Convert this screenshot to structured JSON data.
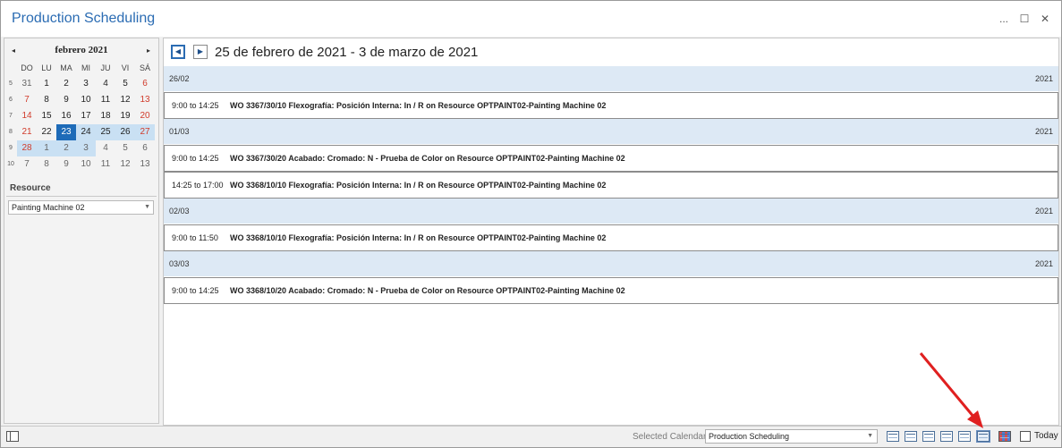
{
  "window": {
    "title": "Production Scheduling",
    "controls": {
      "more": "...",
      "maximize": "☐",
      "close": "✕"
    }
  },
  "mini_calendar": {
    "month_label": "febrero 2021",
    "prev": "◂",
    "next": "▸",
    "weekdays": [
      "DO",
      "LU",
      "MA",
      "MI",
      "JU",
      "VI",
      "SÁ"
    ],
    "weeks": [
      {
        "num": "5",
        "days": [
          "31",
          "1",
          "2",
          "3",
          "4",
          "5",
          "6"
        ]
      },
      {
        "num": "6",
        "days": [
          "7",
          "8",
          "9",
          "10",
          "11",
          "12",
          "13"
        ]
      },
      {
        "num": "7",
        "days": [
          "14",
          "15",
          "16",
          "17",
          "18",
          "19",
          "20"
        ]
      },
      {
        "num": "8",
        "days": [
          "21",
          "22",
          "23",
          "24",
          "25",
          "26",
          "27"
        ]
      },
      {
        "num": "9",
        "days": [
          "28",
          "1",
          "2",
          "3",
          "4",
          "5",
          "6"
        ]
      },
      {
        "num": "10",
        "days": [
          "7",
          "8",
          "9",
          "10",
          "11",
          "12",
          "13"
        ]
      }
    ],
    "selected_day": "23",
    "accent_color": "#1e6bb8",
    "weekend_color": "#d13b2b",
    "range_color": "#c9e0f3"
  },
  "resource": {
    "label": "Resource",
    "selected": "Painting Machine 02"
  },
  "scheduler": {
    "prev_icon": "◀",
    "next_icon": "▶",
    "date_range": "25 de febrero de 2021 - 3 de marzo de 2021",
    "days": [
      {
        "date": "26/02",
        "year": "2021",
        "appointments": [
          {
            "time": "9:00 to 14:25",
            "description": "WO 3367/30/10 Flexografía: Posición Interna: In / R on Resource OPTPAINT02-Painting Machine 02"
          }
        ]
      },
      {
        "date": "01/03",
        "year": "2021",
        "appointments": [
          {
            "time": "9:00 to 14:25",
            "description": "WO 3367/30/20 Acabado: Cromado: N - Prueba de Color on Resource OPTPAINT02-Painting Machine 02"
          },
          {
            "time": "14:25 to 17:00",
            "description": "WO 3368/10/10 Flexografía: Posición Interna: In / R on Resource OPTPAINT02-Painting Machine 02"
          }
        ]
      },
      {
        "date": "02/03",
        "year": "2021",
        "appointments": [
          {
            "time": "9:00 to 11:50",
            "description": "WO 3368/10/10 Flexografía: Posición Interna: In / R on Resource OPTPAINT02-Painting Machine 02"
          }
        ]
      },
      {
        "date": "03/03",
        "year": "2021",
        "appointments": [
          {
            "time": "9:00 to 14:25",
            "description": "WO 3368/10/20 Acabado: Cromado: N - Prueba de Color on Resource OPTPAINT02-Painting Machine 02"
          }
        ]
      }
    ]
  },
  "statusbar": {
    "selected_calendar_label": "Selected Calendar",
    "selected_calendar_value": "Production Scheduling",
    "today_label": "Today",
    "annotation_color": "#e02020"
  }
}
